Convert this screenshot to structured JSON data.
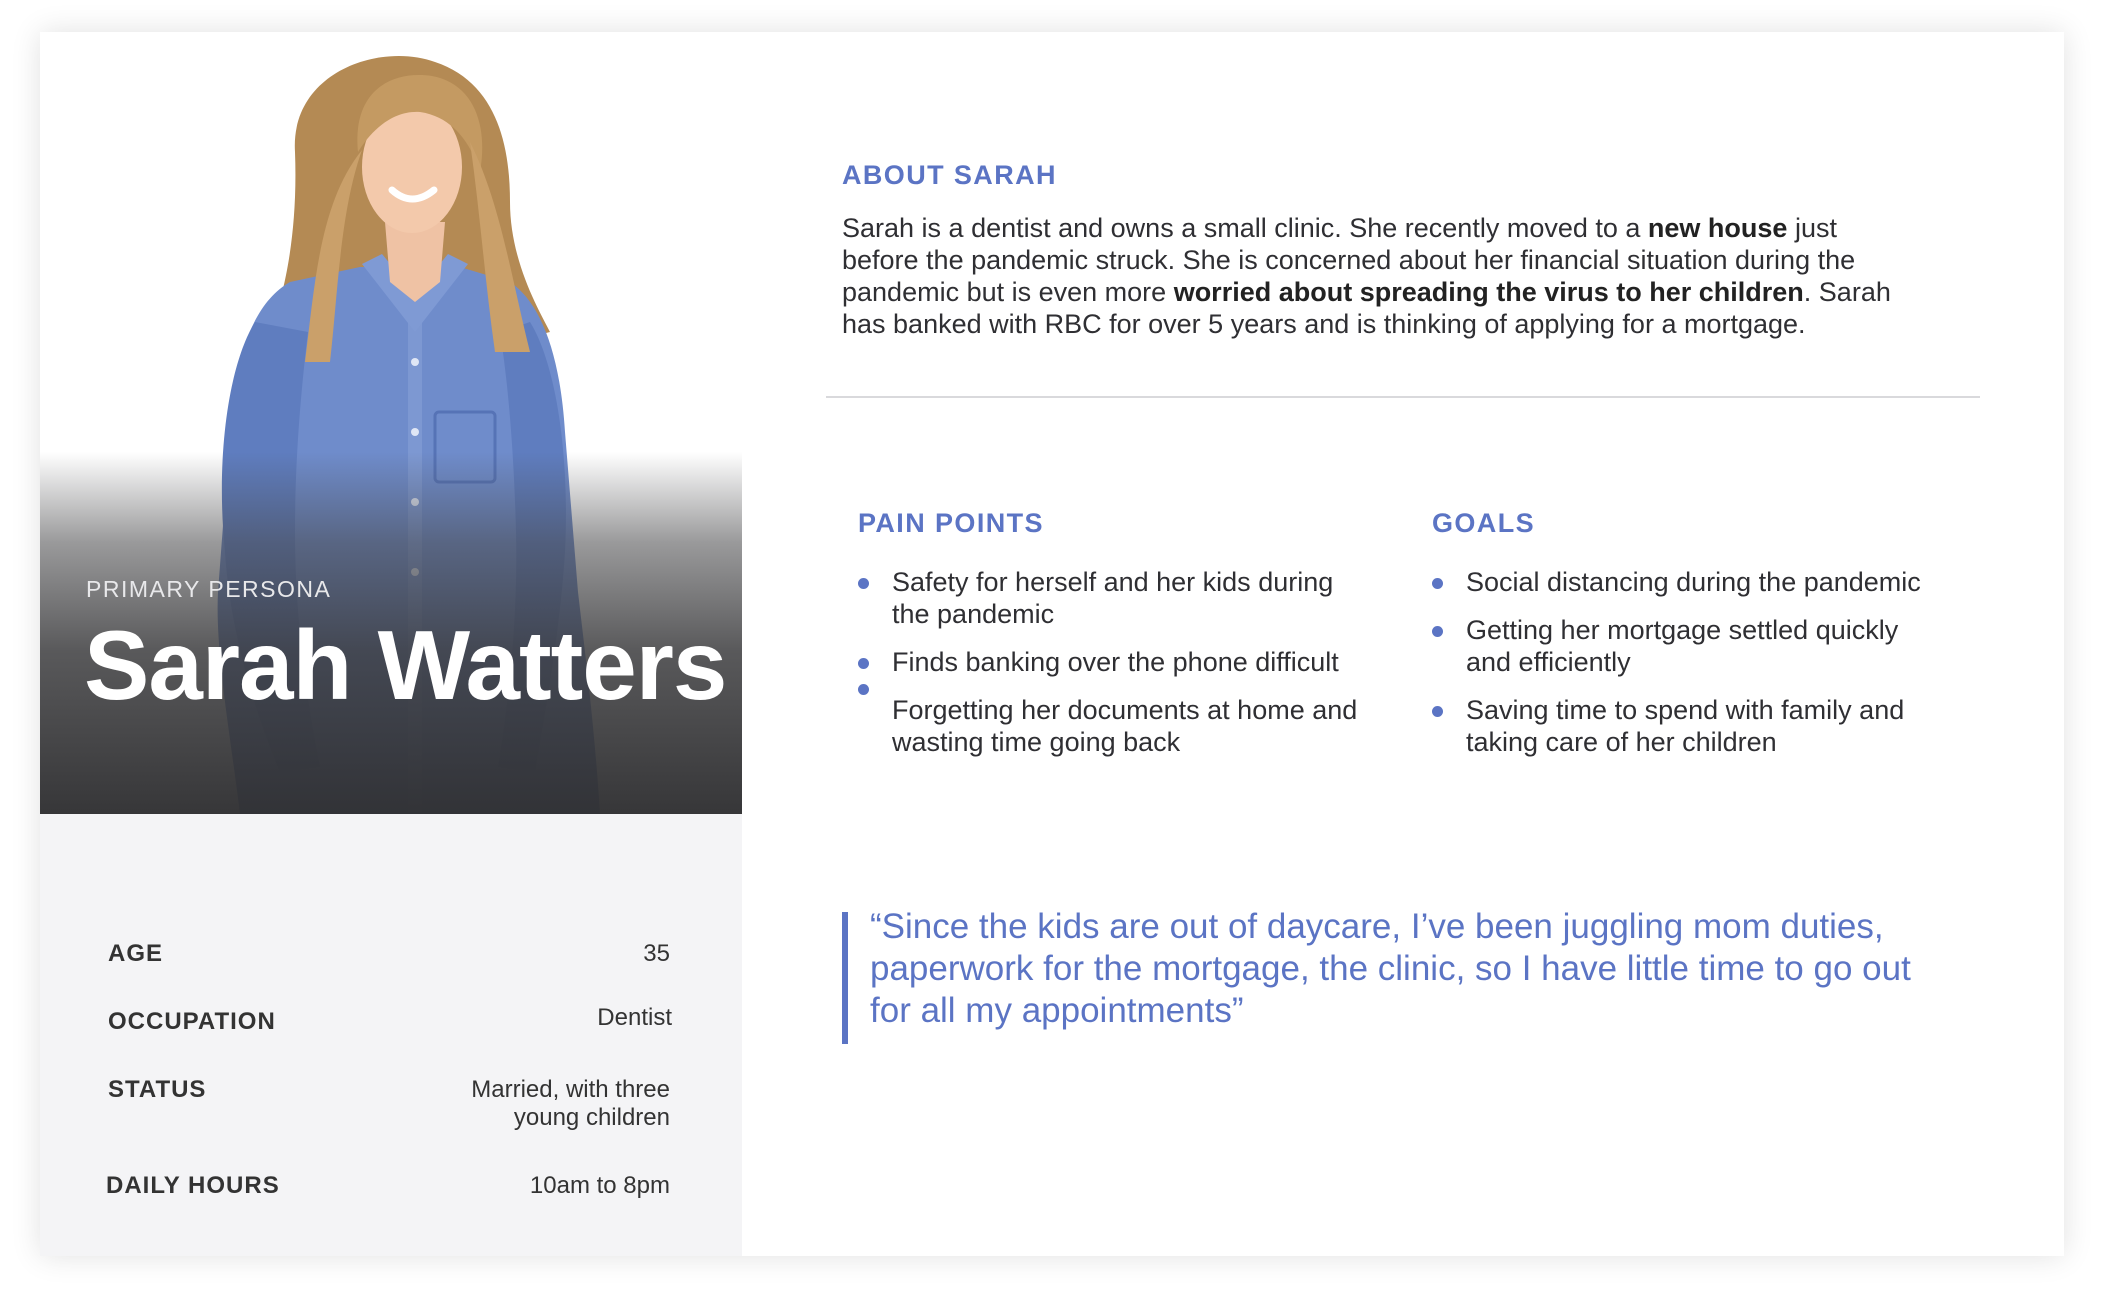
{
  "colors": {
    "accent": "#5b74c4",
    "text": "#2f2f33",
    "panel": "#f4f4f6"
  },
  "persona": {
    "tag": "PRIMARY PERSONA",
    "name": "Sarah Watters"
  },
  "stats": [
    {
      "label": "AGE",
      "value": "35"
    },
    {
      "label": "OCCUPATION",
      "value": "Dentist"
    },
    {
      "label": "STATUS",
      "value_line1": "Married, with three",
      "value_line2": "young children"
    },
    {
      "label": "DAILY HOURS",
      "value": "10am to 8pm"
    }
  ],
  "about": {
    "title": "ABOUT SARAH",
    "text_1": "Sarah is a dentist and owns a small clinic. She recently moved to a ",
    "bold_1": "new house",
    "text_2": " just before the pandemic struck. She is concerned about her financial situation during the pandemic but is even more ",
    "bold_2": "worried about spreading the virus to her children",
    "text_3": ". Sarah has banked with RBC for over 5 years and is thinking of applying for a mortgage."
  },
  "pain_points": {
    "title": "PAIN POINTS",
    "items": [
      "Safety for herself and her kids during the pandemic",
      "Finds banking over the phone difficult",
      "Forgetting her documents at home and wasting time going back"
    ]
  },
  "goals": {
    "title": "GOALS",
    "items": [
      "Social distancing during the pandemic",
      "Getting her mortgage settled quickly and efficiently",
      "Saving time to spend with family and taking care of her children"
    ]
  },
  "quote": {
    "text": "“Since the kids are out of daycare, I’ve been juggling mom duties, paperwork for the mortgage, the clinic, so I have little time to go out for all my appointments”"
  }
}
